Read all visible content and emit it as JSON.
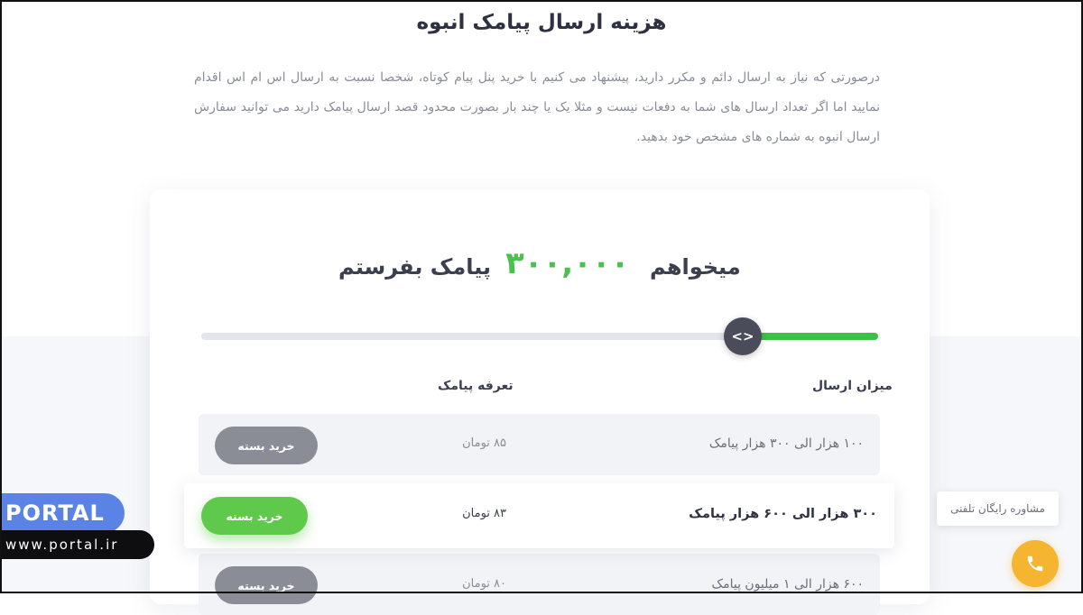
{
  "page": {
    "heading": "هزینه ارسال پیامک انبوه",
    "intro": "درصورتی که نیاز به ارسال دائم و مکرر دارید، پیشنهاد می کنیم با خرید پنل پیام کوتاه، شخصا نسبت به ارسال اس ام اس اقدام نمایید اما اگر تعداد ارسال های شما به دفعات نیست و مثلا یک یا چند بار بصورت محدود قصد ارسال پیامک دارید می توانید سفارش ارسال انبوه به شماره های مشخص خود بدهید."
  },
  "calculator": {
    "want_label": "میخواهم",
    "count_value": "۳۰۰,۰۰۰",
    "send_label": "پیامک بفرستم",
    "slider_level_percent": 20,
    "slider_icon": "code-arrows-icon",
    "slider_glyph": "<>"
  },
  "table": {
    "col_amount": "میزان ارسال",
    "col_rate": "تعرفه پیامک",
    "rows": [
      {
        "label": "۱۰۰ هزار الی ۳۰۰ هزار پیامک",
        "price": "۸۵ تومان",
        "button": "خرید بسته",
        "active": false
      },
      {
        "label": "۳۰۰ هزار الی ۶۰۰ هزار پیامک",
        "price": "۸۳ تومان",
        "button": "خرید بسته",
        "active": true
      },
      {
        "label": "۶۰۰ هزار الی ۱ میلیون پیامک",
        "price": "۸۰ تومان",
        "button": "خرید بسته",
        "active": false
      }
    ]
  },
  "overlay": {
    "brand": "PORTAL",
    "url": "www.portal.ir",
    "consult_text": "مشاوره رایگان تلفنی",
    "phone_icon": "phone-icon"
  },
  "colors": {
    "accent_green": "#4cc04f",
    "button_grey": "#8a8d96",
    "phone_yellow": "#f5b531",
    "portal_blue": "#5b83e6"
  }
}
